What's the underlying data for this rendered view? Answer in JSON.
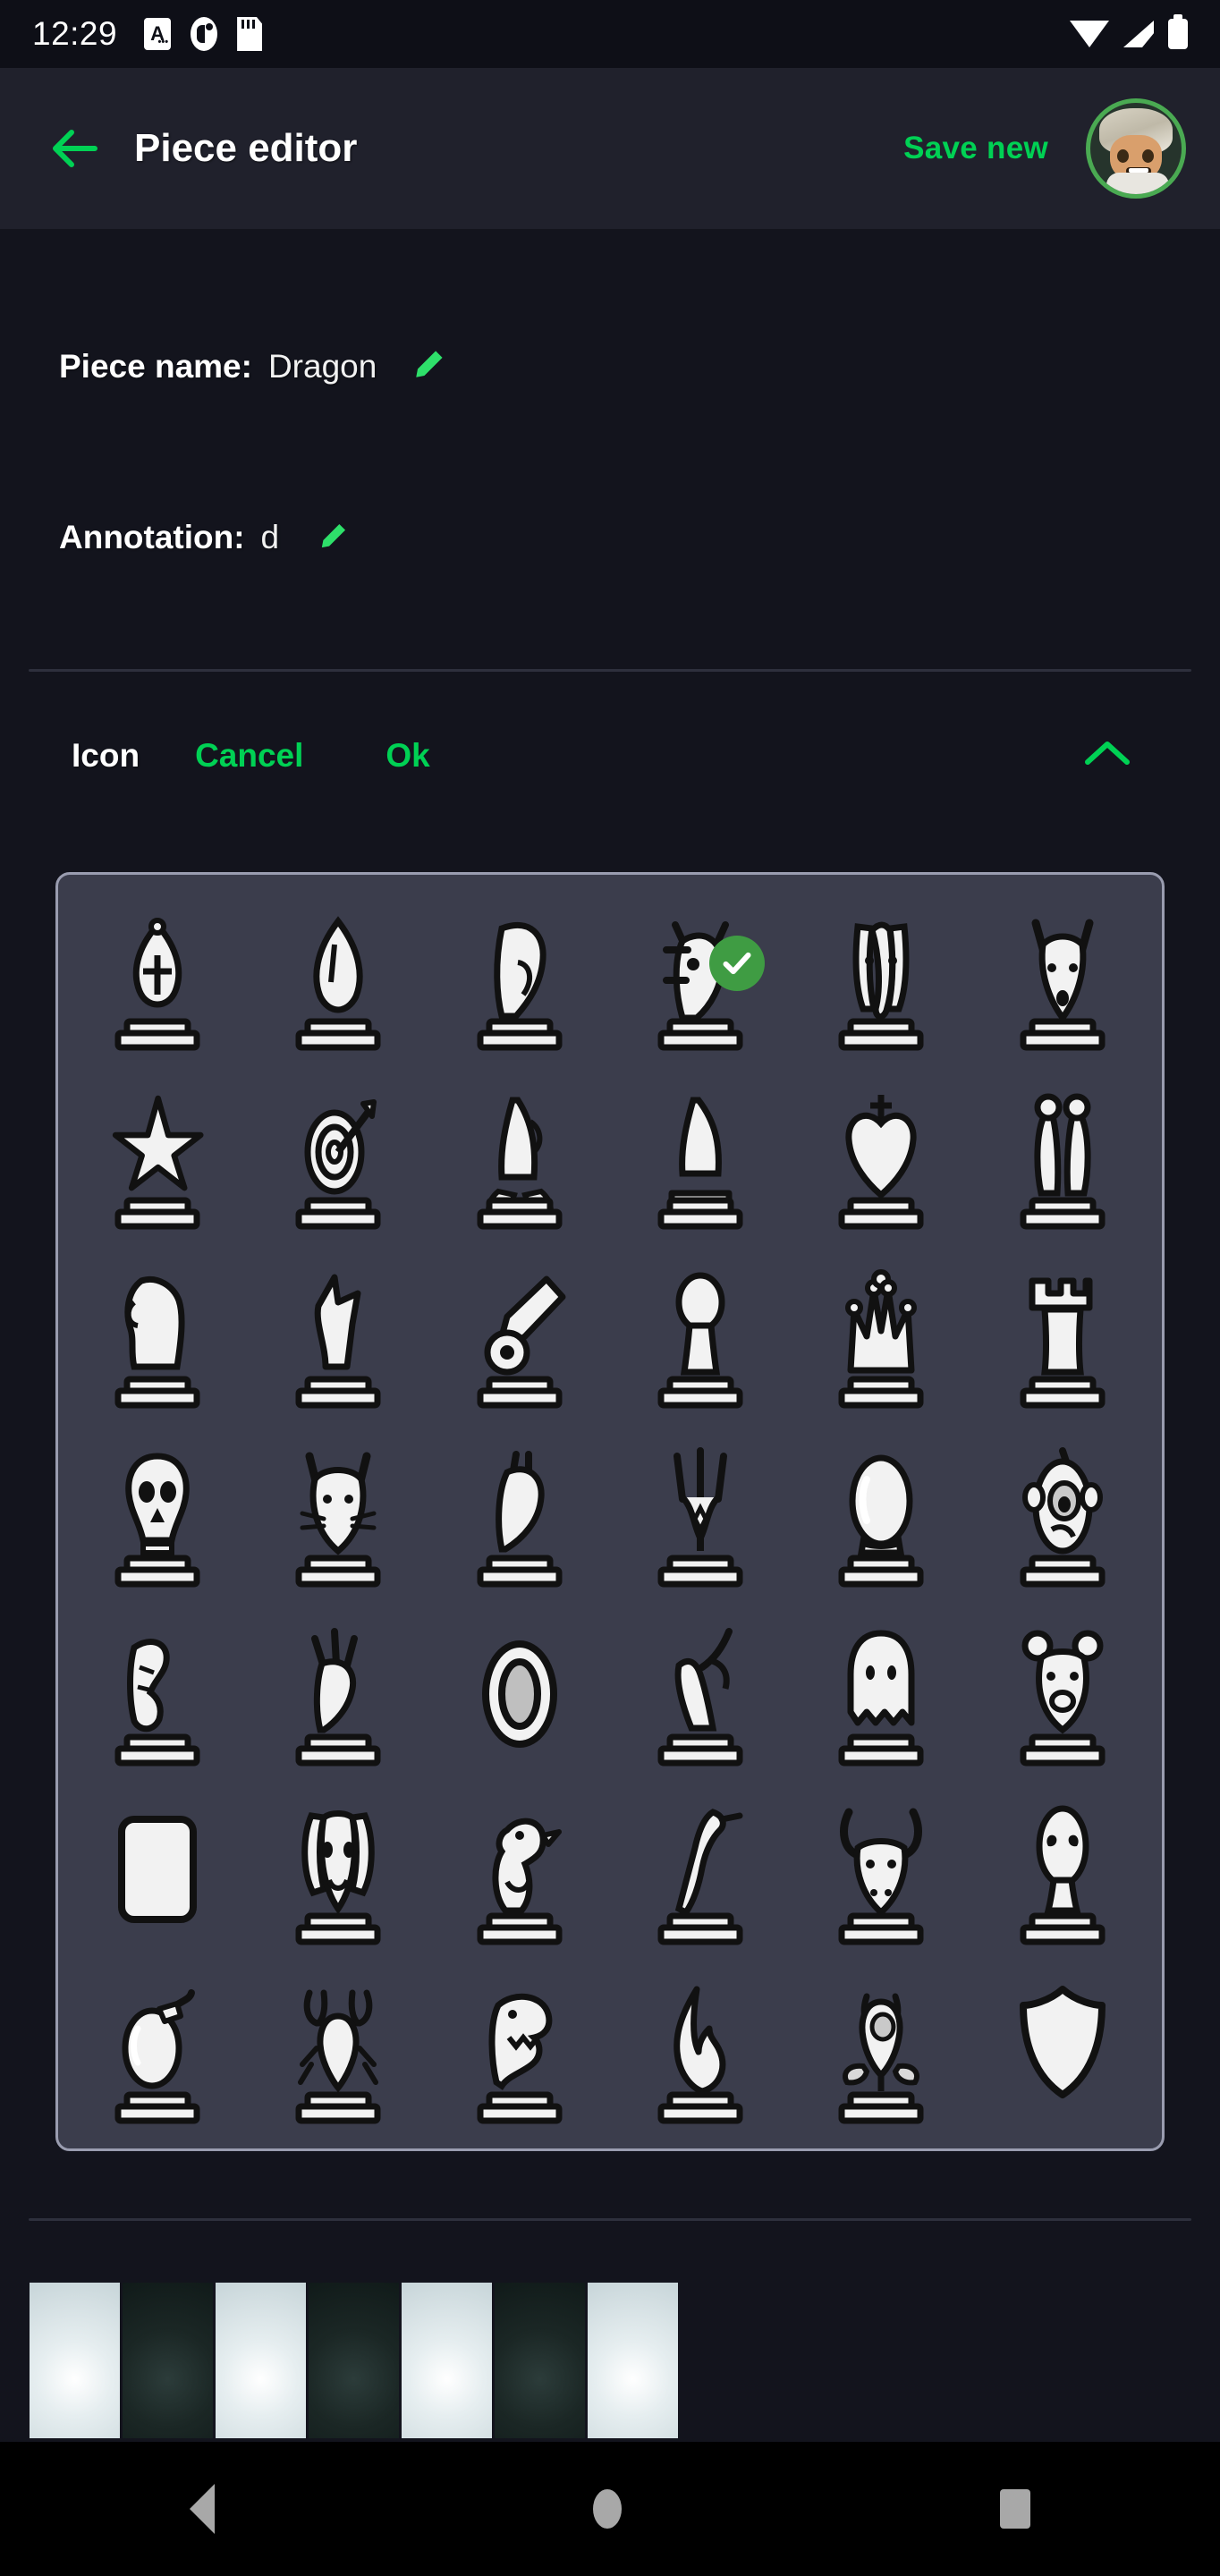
{
  "status_bar": {
    "clock": "12:29",
    "left_icons": [
      "app-notification-icon",
      "oval-notification-icon",
      "sdcard-icon"
    ],
    "right_icons": [
      "wifi-icon",
      "cellular-signal-icon",
      "battery-icon"
    ]
  },
  "app_bar": {
    "back_label": "back-arrow-icon",
    "title": "Piece editor",
    "save_label": "Save new",
    "avatar_label": "user-avatar"
  },
  "fields": {
    "piece_name": {
      "label": "Piece name:",
      "value": "Dragon",
      "edit_icon": "pencil-icon"
    },
    "annotation": {
      "label": "Annotation:",
      "value": "d",
      "edit_icon": "pencil-icon"
    }
  },
  "icon_section": {
    "label": "Icon",
    "cancel_label": "Cancel",
    "ok_label": "Ok",
    "collapse_icon": "chevron-up-icon"
  },
  "colors": {
    "accent_green": "#00d154",
    "check_green": "#3f9c43",
    "appbar_bg": "#20212c",
    "page_bg": "#13141d",
    "status_bg": "#0e0f17",
    "panel_bg": "#3b3d4c",
    "panel_border": "#9a9db0"
  },
  "icon_grid": {
    "columns": 6,
    "rows": 7,
    "selected_index": 3,
    "items": [
      {
        "name": "bishop-cross-icon",
        "glyph": "bishop-cross"
      },
      {
        "name": "bishop-icon",
        "glyph": "bishop"
      },
      {
        "name": "knight-helmet-icon",
        "glyph": "helmet"
      },
      {
        "name": "dragon-icon",
        "glyph": "dragon"
      },
      {
        "name": "elephant-icon",
        "glyph": "elephant"
      },
      {
        "name": "wolf-head-icon",
        "glyph": "wolf-head"
      },
      {
        "name": "star-icon",
        "glyph": "star"
      },
      {
        "name": "target-arrow-icon",
        "glyph": "target"
      },
      {
        "name": "knight-tassel-icon",
        "glyph": "knight-tassel"
      },
      {
        "name": "knight-tower-icon",
        "glyph": "knight-tower"
      },
      {
        "name": "king-heart-icon",
        "glyph": "king-heart"
      },
      {
        "name": "twin-figures-icon",
        "glyph": "twins"
      },
      {
        "name": "knight-icon",
        "glyph": "knight"
      },
      {
        "name": "knight-angular-icon",
        "glyph": "knight-angular"
      },
      {
        "name": "cannon-icon",
        "glyph": "cannon"
      },
      {
        "name": "pawn-icon",
        "glyph": "pawn"
      },
      {
        "name": "queen-icon",
        "glyph": "queen"
      },
      {
        "name": "rook-icon",
        "glyph": "rook"
      },
      {
        "name": "skull-icon",
        "glyph": "skull"
      },
      {
        "name": "cat-icon",
        "glyph": "cat"
      },
      {
        "name": "horse-head-icon",
        "glyph": "horse-head"
      },
      {
        "name": "trident-icon",
        "glyph": "trident"
      },
      {
        "name": "orb-icon",
        "glyph": "orb"
      },
      {
        "name": "cyclops-icon",
        "glyph": "cyclops"
      },
      {
        "name": "howling-wolf-icon",
        "glyph": "howling-wolf"
      },
      {
        "name": "crowned-horse-icon",
        "glyph": "crowned-horse"
      },
      {
        "name": "ring-icon",
        "glyph": "ring"
      },
      {
        "name": "leaping-deer-icon",
        "glyph": "deer"
      },
      {
        "name": "ghost-icon",
        "glyph": "ghost"
      },
      {
        "name": "bear-icon",
        "glyph": "bear"
      },
      {
        "name": "blank-square-icon",
        "glyph": "blank"
      },
      {
        "name": "dog-icon",
        "glyph": "dog"
      },
      {
        "name": "duck-icon",
        "glyph": "duck"
      },
      {
        "name": "heron-icon",
        "glyph": "heron"
      },
      {
        "name": "bull-icon",
        "glyph": "bull"
      },
      {
        "name": "alien-icon",
        "glyph": "alien"
      },
      {
        "name": "bomb-icon",
        "glyph": "bomb"
      },
      {
        "name": "crab-icon",
        "glyph": "crab"
      },
      {
        "name": "dinosaur-icon",
        "glyph": "dinosaur"
      },
      {
        "name": "flame-icon",
        "glyph": "flame"
      },
      {
        "name": "rose-icon",
        "glyph": "rose"
      },
      {
        "name": "shield-icon",
        "glyph": "shield"
      }
    ]
  },
  "color_swatches": [
    {
      "name": "swatch-light-1",
      "tone": "light"
    },
    {
      "name": "swatch-dark-1",
      "tone": "dark"
    },
    {
      "name": "swatch-light-2",
      "tone": "light"
    },
    {
      "name": "swatch-dark-2",
      "tone": "dark"
    },
    {
      "name": "swatch-light-3",
      "tone": "light"
    },
    {
      "name": "swatch-dark-3",
      "tone": "dark"
    },
    {
      "name": "swatch-light-4",
      "tone": "light"
    }
  ],
  "nav_bar": {
    "back": "nav-back-icon",
    "home": "nav-home-icon",
    "recents": "nav-recents-icon"
  }
}
